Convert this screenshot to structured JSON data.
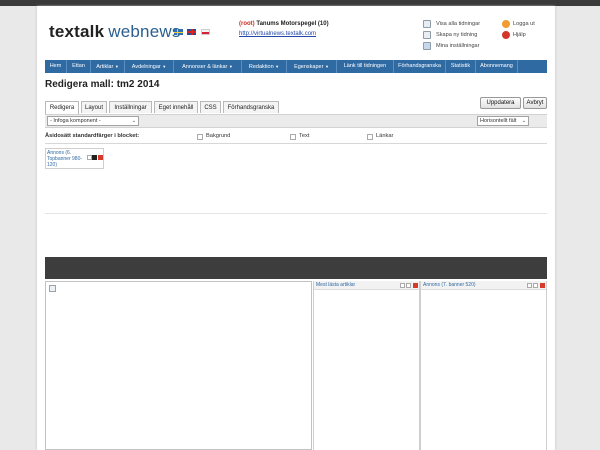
{
  "header": {
    "logo_part1": "textalk",
    "logo_part2": "webnews",
    "flags": [
      "swedish-flag",
      "uk-flag",
      "polish-flag"
    ],
    "site_root": "(root)",
    "site_name": "Tanums Motorspegel (10)",
    "site_url": "http://virtualnews.textalk.com",
    "links": [
      "Visa alla tidningar",
      "Skapa ny tidning",
      "Mina inställningar"
    ],
    "links2": [
      "Logga ut",
      "Hjälp"
    ]
  },
  "nav": {
    "items": [
      {
        "label": "Hem",
        "dropdown": false
      },
      {
        "label": "Ettan",
        "dropdown": false
      },
      {
        "label": "Artiklar",
        "dropdown": true
      },
      {
        "label": "Avdelningar",
        "dropdown": true
      },
      {
        "label": "Annonser & länkar",
        "dropdown": true
      },
      {
        "label": "Redaktion",
        "dropdown": true
      },
      {
        "label": "Egenskaper",
        "dropdown": true
      },
      {
        "label": "Länk till tidningen",
        "dropdown": false
      },
      {
        "label": "Förhandsgranska",
        "dropdown": false
      },
      {
        "label": "Statistik",
        "dropdown": false
      },
      {
        "label": "Abonnemang",
        "dropdown": false
      }
    ]
  },
  "page_title": "Redigera mall: tm2 2014",
  "tabs": [
    {
      "label": "Redigera",
      "active": true
    },
    {
      "label": "Layout",
      "active": false
    },
    {
      "label": "Inställningar",
      "active": false
    },
    {
      "label": "Eget innehåll",
      "active": false
    },
    {
      "label": "CSS",
      "active": false
    },
    {
      "label": "Förhandsgranska",
      "active": false
    }
  ],
  "buttons": {
    "update": "Uppdatera",
    "cancel": "Avbryt"
  },
  "toolbar": {
    "insert_component": "- Infoga komponent -",
    "orientation": "Horisontellt fält"
  },
  "color_row": {
    "label": "Åsidosätt standardfärger i blocket:",
    "options": [
      "Bakgrund",
      "Text",
      "Länkar"
    ]
  },
  "block": {
    "label": "Annons (6. Topbanner 980-120)"
  },
  "columns": [
    {
      "title": "Mest lästa artiklar"
    },
    {
      "title": "Annons (7. banner 520)"
    }
  ],
  "colors": {
    "nav": "#2f6aa3",
    "dark_bar": "#3d3d3d",
    "accent_red": "#c82a1e"
  }
}
